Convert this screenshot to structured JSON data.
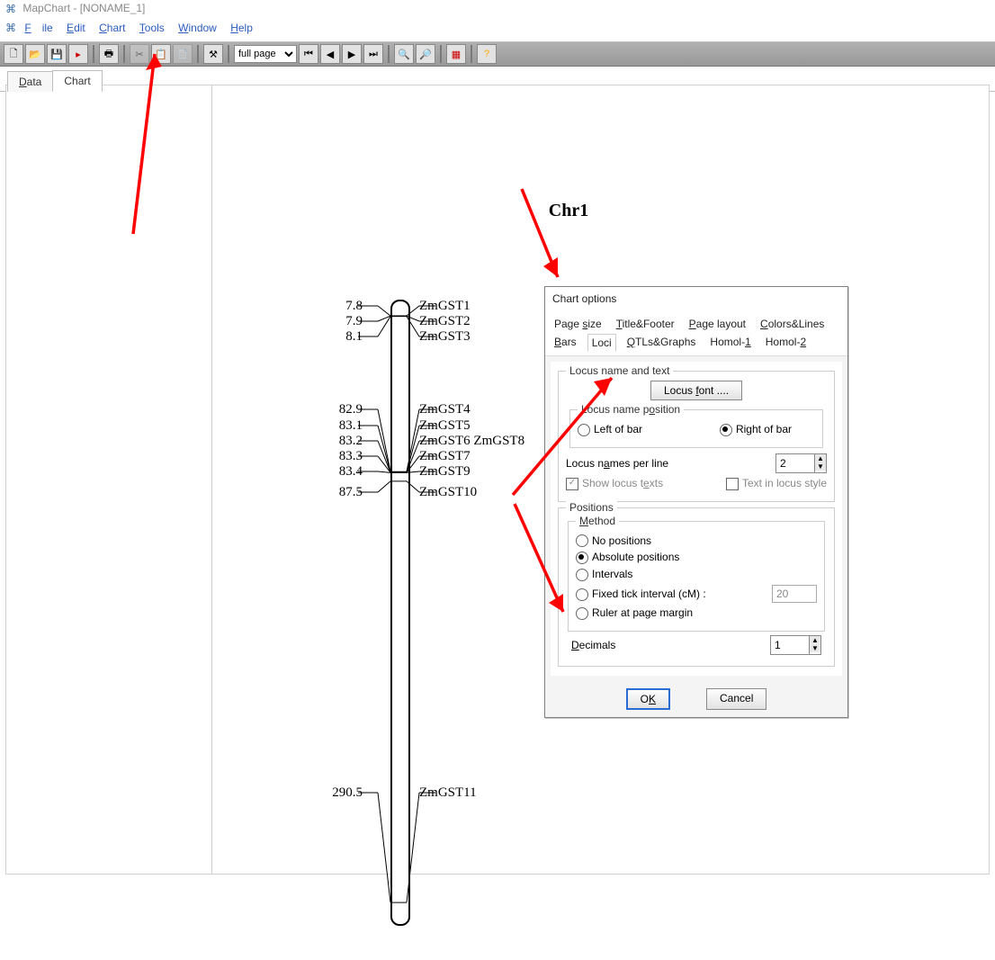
{
  "window": {
    "title": "MapChart - [NONAME_1]"
  },
  "menu": {
    "file": "File",
    "edit": "Edit",
    "chart": "Chart",
    "tools": "Tools",
    "window": "Window",
    "help": "Help"
  },
  "toolbar": {
    "zoom_value": "full page"
  },
  "main_tabs": {
    "data": "Data",
    "chart": "Chart"
  },
  "chart": {
    "chr_title": "Chr1",
    "loci": [
      {
        "pos": "7.8",
        "name": "ZmGST1"
      },
      {
        "pos": "7.9",
        "name": "ZmGST2"
      },
      {
        "pos": "8.1",
        "name": "ZmGST3"
      },
      {
        "pos": "82.9",
        "name": "ZmGST4"
      },
      {
        "pos": "83.1",
        "name": "ZmGST5"
      },
      {
        "pos": "83.2",
        "name": "ZmGST6 ZmGST8"
      },
      {
        "pos": "83.3",
        "name": "ZmGST7"
      },
      {
        "pos": "83.4",
        "name": "ZmGST9"
      },
      {
        "pos": "87.5",
        "name": "ZmGST10"
      },
      {
        "pos": "290.5",
        "name": "ZmGST11"
      }
    ]
  },
  "dialog": {
    "title": "Chart options",
    "tabs_row1": {
      "page_size": "Page size",
      "title_footer": "Title&Footer",
      "page_layout": "Page layout",
      "colors_lines": "Colors&Lines"
    },
    "tabs_row2": {
      "bars": "Bars",
      "loci": "Loci",
      "qtls": "QTLs&Graphs",
      "homol1": "Homol-1",
      "homol2": "Homol-2"
    },
    "grp_name_text": "Locus name and text",
    "locus_font_btn": "Locus font ....",
    "grp_name_pos": "Locus name position",
    "opt_left": "Left of bar",
    "opt_right": "Right of bar",
    "names_per_line_lbl": "Locus names per line",
    "names_per_line_val": "2",
    "show_locus_texts": "Show locus texts",
    "text_in_locus_style": "Text in locus style",
    "grp_positions": "Positions",
    "grp_method": "Method",
    "opt_no_pos": "No positions",
    "opt_abs_pos": "Absolute positions",
    "opt_intervals": "Intervals",
    "opt_fixed_tick": "Fixed tick interval (cM) :",
    "fixed_tick_val": "20",
    "opt_ruler": "Ruler at page margin",
    "decimals_lbl": "Decimals",
    "decimals_val": "1",
    "ok": "OK",
    "cancel": "Cancel"
  }
}
